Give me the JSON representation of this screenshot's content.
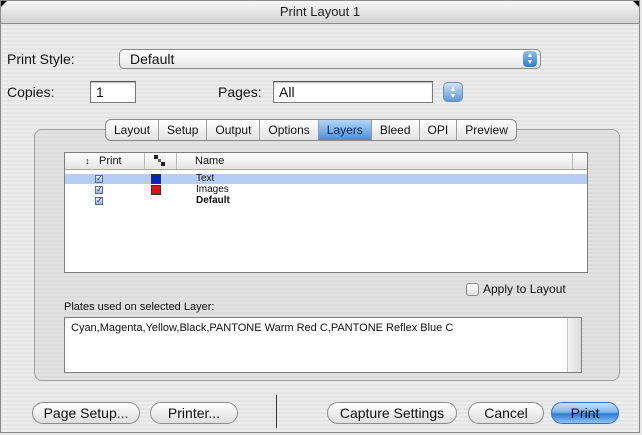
{
  "window": {
    "title": "Print Layout 1"
  },
  "print_style": {
    "label": "Print Style:",
    "value": "Default"
  },
  "copies": {
    "label": "Copies:",
    "value": "1"
  },
  "pages": {
    "label": "Pages:",
    "value": "All"
  },
  "tabs": [
    {
      "label": "Layout",
      "active": false
    },
    {
      "label": "Setup",
      "active": false
    },
    {
      "label": "Output",
      "active": false
    },
    {
      "label": "Options",
      "active": false
    },
    {
      "label": "Layers",
      "active": true
    },
    {
      "label": "Bleed",
      "active": false
    },
    {
      "label": "OPI",
      "active": false
    },
    {
      "label": "Preview",
      "active": false
    }
  ],
  "layers_table": {
    "sort_indicator": "↕",
    "headers": {
      "print": "Print",
      "name": "Name"
    },
    "rows": [
      {
        "name": "Text",
        "print": true,
        "color": "#0022cc",
        "selected": true,
        "bold": false
      },
      {
        "name": "Images",
        "print": true,
        "color": "#dd1111",
        "selected": false,
        "bold": false
      },
      {
        "name": "Default",
        "print": true,
        "color": null,
        "selected": false,
        "bold": true
      }
    ]
  },
  "apply_to_layout": {
    "label": "Apply to Layout",
    "checked": false
  },
  "plates": {
    "label": "Plates used on selected Layer:",
    "value": "Cyan,Magenta,Yellow,Black,PANTONE Warm Red C,PANTONE Reflex Blue C"
  },
  "buttons": {
    "page_setup": "Page Setup...",
    "printer": "Printer...",
    "capture_settings": "Capture Settings",
    "cancel": "Cancel",
    "print": "Print"
  },
  "colors": {
    "accent": "#4b8fdc",
    "selection": "#b5cdf2"
  }
}
